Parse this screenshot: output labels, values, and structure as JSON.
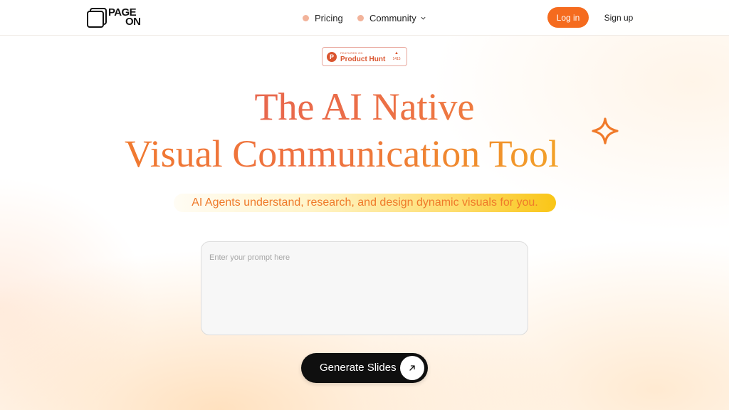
{
  "header": {
    "logo": {
      "line1": "PAGE",
      "line2": "ON"
    },
    "nav": [
      {
        "label": "Pricing",
        "icon": "dot"
      },
      {
        "label": "Community",
        "icon": "dot",
        "dropdown_icon": "chevron-down-icon"
      }
    ],
    "login_label": "Log in",
    "signup_label": "Sign up"
  },
  "product_hunt": {
    "featured_text": "FEATURED ON",
    "name": "Product Hunt",
    "upvote_icon": "triangle-up-icon",
    "vote_count": "1415"
  },
  "hero": {
    "title_line1": "The AI Native",
    "title_line2": "Visual Communication Tool",
    "sparkle_icon": "sparkle-icon",
    "subtitle": "AI Agents understand, research, and design dynamic visuals for you."
  },
  "prompt": {
    "placeholder": "Enter your prompt here",
    "value": ""
  },
  "generate_button": {
    "label": "Generate Slides",
    "icon": "arrow-up-right-icon"
  },
  "colors": {
    "accent": "#f56b1e",
    "product_hunt": "#da552f",
    "button_dark": "#0f0f0f",
    "subtitle_highlight": "#f9c516"
  }
}
